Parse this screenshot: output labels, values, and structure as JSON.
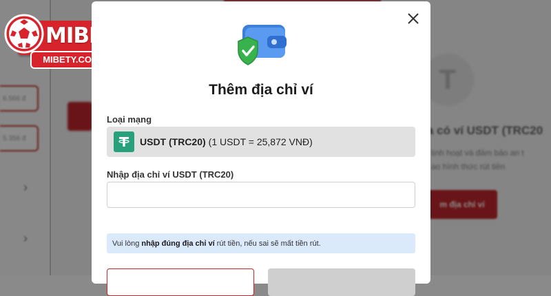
{
  "background": {
    "amounts": [
      "6.566 đ",
      "5.356 đ"
    ],
    "right_title": "a có ví USDT (TRC20",
    "right_text_lines": [
      "linh hoạt và đảm bảo an t",
      "ao hình thức rút tiền"
    ],
    "right_button": "m địa chỉ ví",
    "right_icon": "T"
  },
  "logo": {
    "brand": "MIBET",
    "url": "MIBETY.COM",
    "colors": {
      "red": "#d7242c",
      "white": "#ffffff"
    }
  },
  "modal": {
    "title": "Thêm địa chỉ ví",
    "close_icon": "close-icon",
    "illustration_icon": "wallet-shield-icon",
    "network_label": "Loại mạng",
    "network": {
      "icon": "tether-icon",
      "name": "USDT (TRC20)",
      "rate": "(1 USDT = 25,872 VNĐ)"
    },
    "address_label": "Nhập địa chỉ ví USDT (TRC20)",
    "address_value": "",
    "notice": {
      "prefix": "Vui lòng",
      "emphasis": "nhập đúng địa chỉ ví",
      "suffix": "rút tiền, nếu sai sẽ mất tiền rút."
    }
  },
  "colors": {
    "accent": "#c0262c",
    "tether_green": "#26a17b",
    "notice_bg": "#dbeafb"
  }
}
